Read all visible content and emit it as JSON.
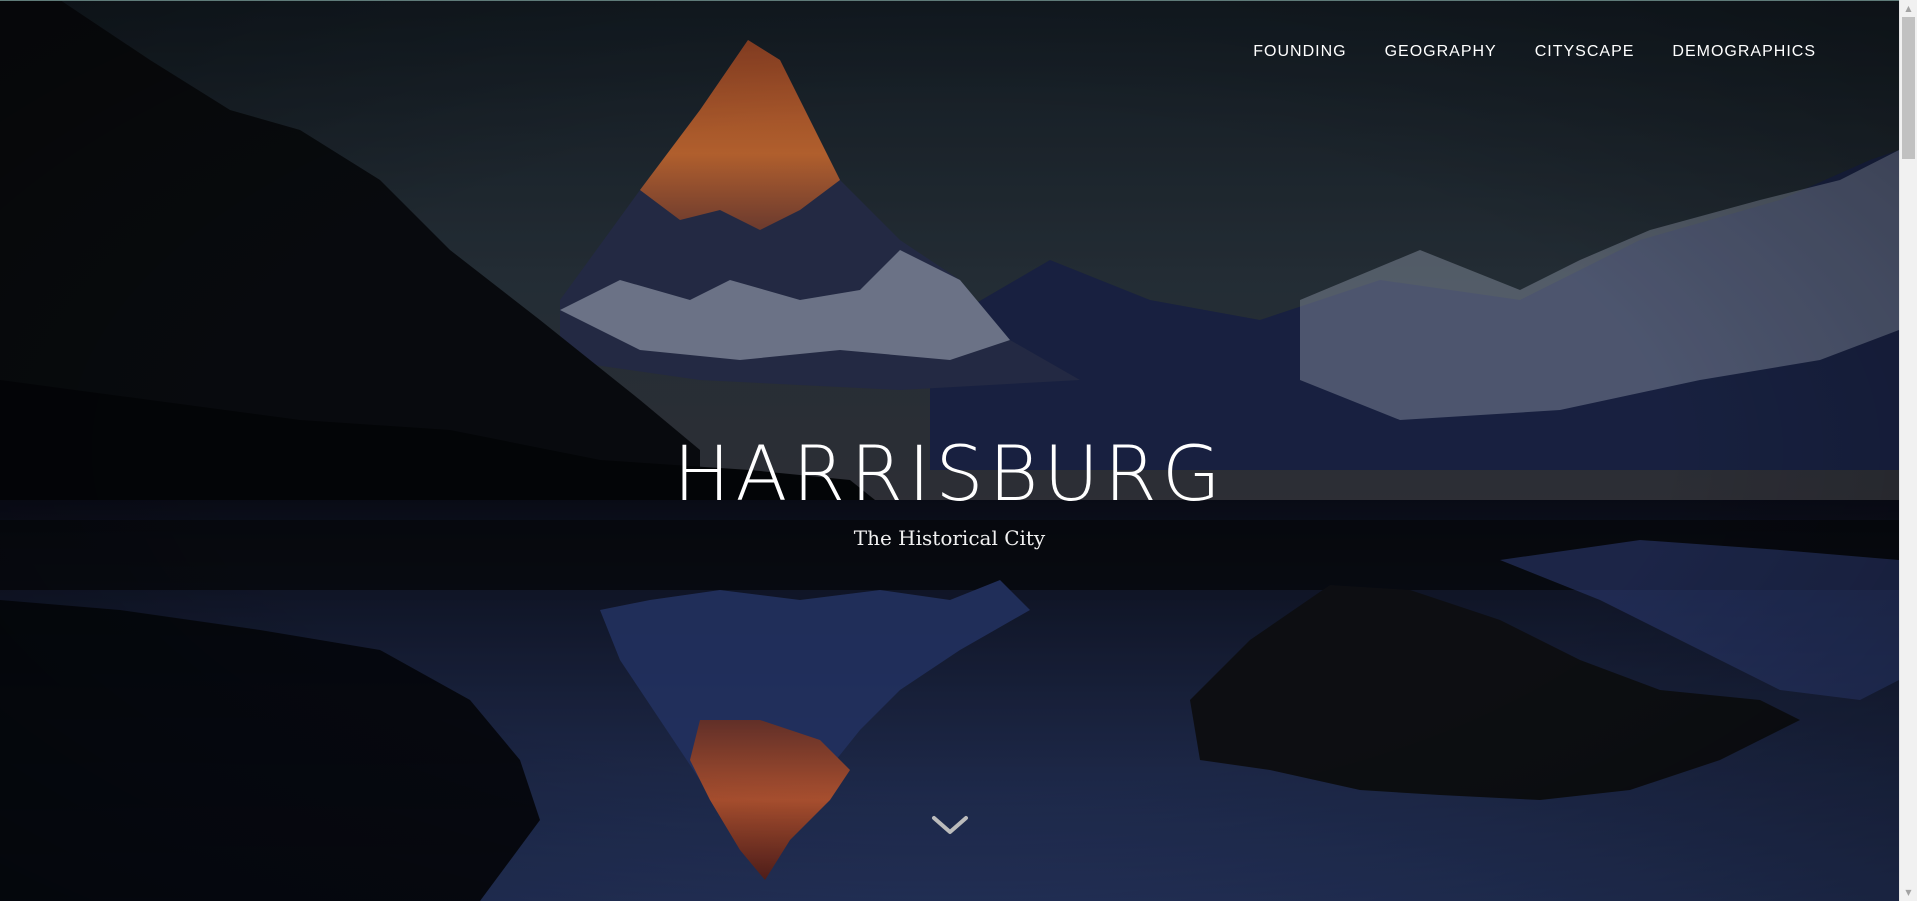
{
  "nav": {
    "items": [
      {
        "label": "FOUNDING"
      },
      {
        "label": "GEOGRAPHY"
      },
      {
        "label": "CITYSCAPE"
      },
      {
        "label": "DEMOGRAPHICS"
      }
    ]
  },
  "hero": {
    "title": "HARRISBURG",
    "subtitle": "The Historical City",
    "scroll_icon": "chevron-down-icon"
  },
  "colors": {
    "text": "#ffffff",
    "sky_top": "#1b2630",
    "water": "#2f4277",
    "peak_glow": "#d96b35"
  },
  "scrollbar": {
    "position": 0
  }
}
